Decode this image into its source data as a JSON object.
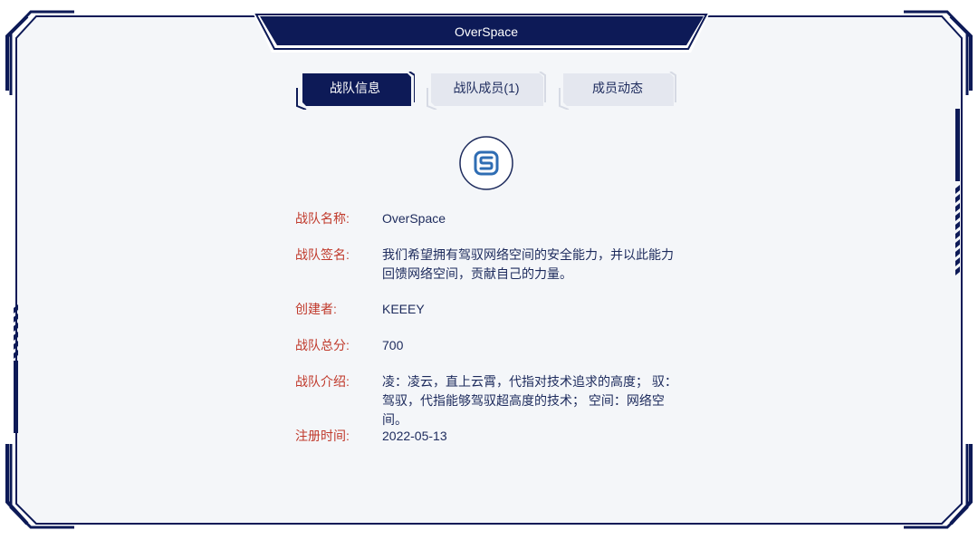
{
  "header": {
    "title": "OverSpace"
  },
  "tabs": [
    {
      "label": "战队信息",
      "active": true
    },
    {
      "label": "战队成员(1)",
      "active": false
    },
    {
      "label": "成员动态",
      "active": false
    }
  ],
  "team": {
    "logo_icon": "team-logo-icon",
    "fields": [
      {
        "label": "战队名称:",
        "value": "OverSpace"
      },
      {
        "label": "战队签名:",
        "value": "我们希望拥有驾驭网络空间的安全能力，并以此能力回馈网络空间，贡献自己的力量。"
      },
      {
        "label": "创建者:",
        "value": "KEEEY"
      },
      {
        "label": "战队总分:",
        "value": "700"
      },
      {
        "label": "战队介绍:",
        "value": "凌：凌云，直上云霄，代指对技术追求的高度； 驭：驾驭，代指能够驾驭超高度的技术； 空间：网络空间。"
      },
      {
        "label": "注册时间:",
        "value": "2022-05-13"
      }
    ]
  },
  "colors": {
    "navy": "#0d1a57",
    "panel_bg": "#f4f6f9",
    "label_red": "#c0392b",
    "text_navy": "#1c2a5c",
    "tab_inactive": "#e4e7ef",
    "logo_blue": "#2f6db3"
  }
}
